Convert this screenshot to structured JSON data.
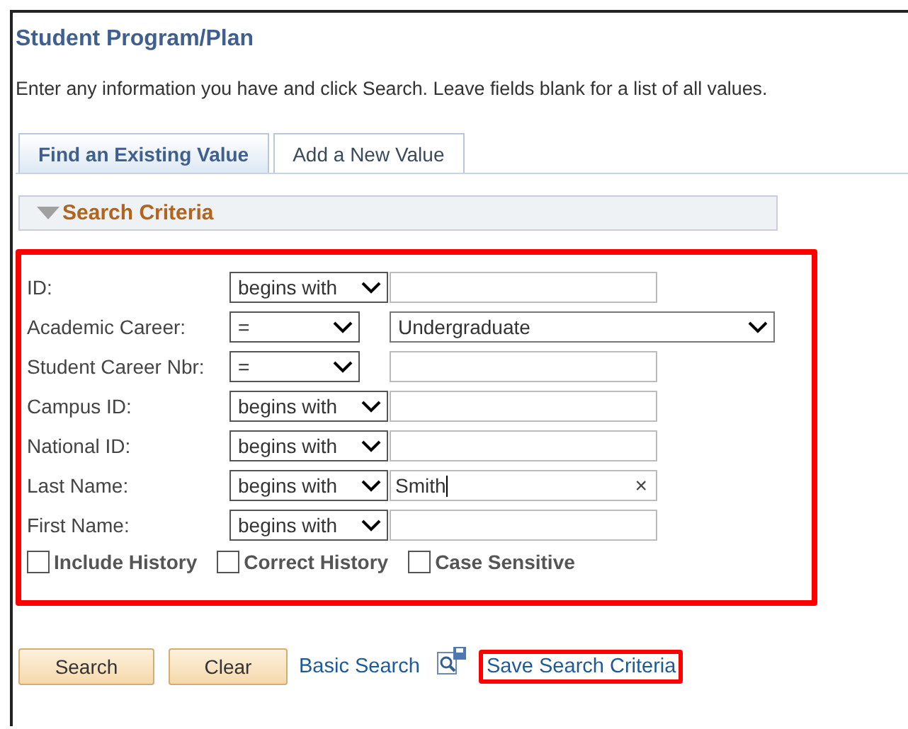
{
  "page_title": "Student Program/Plan",
  "instructions": "Enter any information you have and click Search. Leave fields blank for a list of all values.",
  "tabs": [
    {
      "label": "Find an Existing Value",
      "selected": true
    },
    {
      "label": "Add a New Value",
      "selected": false
    }
  ],
  "section": {
    "title": "Search Criteria",
    "expanded": true
  },
  "criteria": {
    "highlighted": true,
    "fields": [
      {
        "label": "ID:",
        "operator": "begins with",
        "kind": "text"
      },
      {
        "label": "Academic Career:",
        "operator": "=",
        "kind": "select",
        "value": "Undergraduate"
      },
      {
        "label": "Student Career Nbr:",
        "operator": "=",
        "kind": "text"
      },
      {
        "label": "Campus ID:",
        "operator": "begins with",
        "kind": "text"
      },
      {
        "label": "National ID:",
        "operator": "begins with",
        "kind": "text"
      },
      {
        "label": "Last Name:",
        "operator": "begins with",
        "kind": "text",
        "value": "Smith",
        "clear": "×"
      },
      {
        "label": "First Name:",
        "operator": "begins with",
        "kind": "text"
      }
    ],
    "checkboxes": [
      {
        "label": "Include History",
        "checked": false
      },
      {
        "label": "Correct History",
        "checked": false
      },
      {
        "label": "Case Sensitive",
        "checked": false
      }
    ]
  },
  "buttons": [
    "Search",
    "Clear"
  ],
  "links": [
    {
      "label": "Basic Search",
      "highlighted": false
    },
    {
      "label": "Save Search Criteria",
      "highlighted": true
    }
  ]
}
